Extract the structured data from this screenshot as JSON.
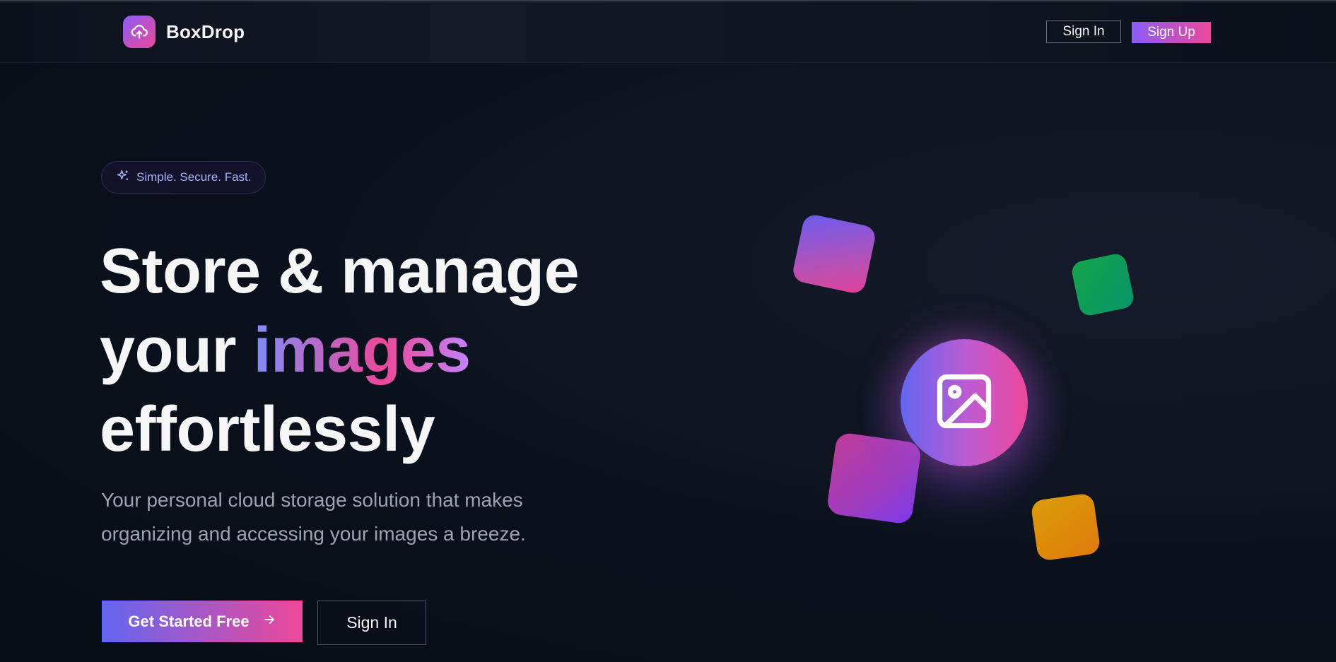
{
  "brand": {
    "name": "BoxDrop",
    "logo_icon": "cloud-upload-icon"
  },
  "nav": {
    "sign_in": "Sign In",
    "sign_up": "Sign Up"
  },
  "hero": {
    "badge": {
      "icon": "sparkles-icon",
      "text": "Simple. Secure. Fast."
    },
    "headline": {
      "line1": "Store & manage",
      "line2_pre": "your ",
      "line2_highlight": "images",
      "line3": "effortlessly"
    },
    "subtitle": "Your personal cloud storage solution that makes organizing and accessing your images a breeze.",
    "cta_primary": "Get Started Free",
    "cta_primary_icon": "arrow-right-icon",
    "cta_secondary": "Sign In"
  },
  "illustration": {
    "center_icon": "image-icon",
    "tile_colors": [
      "#8b5cf6",
      "#16a34a",
      "#be3d9a",
      "#d99d0a"
    ]
  },
  "colors": {
    "accent_start": "#6366f1",
    "accent_end": "#ec4899",
    "background": "#0b111c"
  }
}
